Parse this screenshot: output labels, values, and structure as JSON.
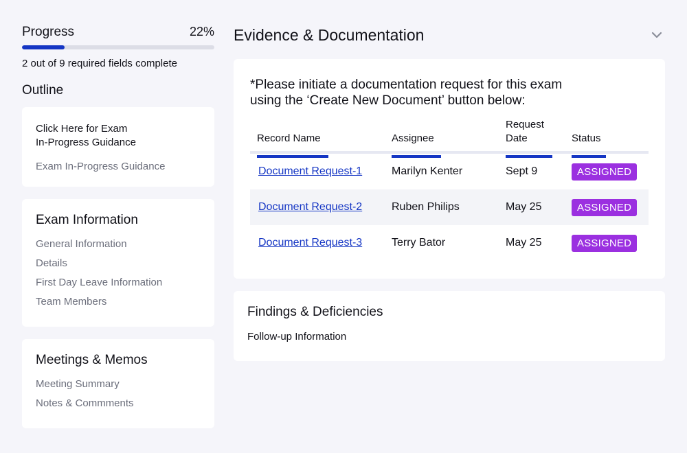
{
  "progress": {
    "title": "Progress",
    "percent_label": "22%",
    "percent": 22,
    "status_text": "2 out of 9 required fields complete",
    "accent": "#1536c4"
  },
  "outline": {
    "title": "Outline",
    "guidance": {
      "link": "Click Here for Exam\nIn-Progress Guidance",
      "sub": "Exam In-Progress Guidance"
    },
    "exam_information": {
      "title": "Exam Information",
      "items": [
        "General Information",
        "Details",
        "First Day Leave Information",
        "Team Members"
      ]
    },
    "meetings_memos": {
      "title": "Meetings & Memos",
      "items": [
        "Meeting Summary",
        "Notes & Commments"
      ]
    }
  },
  "evidence": {
    "title": "Evidence & Documentation",
    "chevron_icon": "chevron-down-icon",
    "instruction": "*Please initiate a documentation request for this exam\nusing the ‘Create New Document’ button below:",
    "columns": [
      "Record Name",
      "Assignee",
      "Request\nDate",
      "Status"
    ],
    "rows": [
      {
        "record": "Document Request-1",
        "assignee": "Marilyn Kenter",
        "date": "Sept 9",
        "status": "ASSIGNED"
      },
      {
        "record": "Document Request-2",
        "assignee": "Ruben Philips",
        "date": "May 25",
        "status": "ASSIGNED"
      },
      {
        "record": "Document Request-3",
        "assignee": "Terry Bator",
        "date": "May 25",
        "status": "ASSIGNED"
      }
    ],
    "status_color": "#9b30e0"
  },
  "findings": {
    "title": "Findings & Deficiencies",
    "item": "Follow-up Information"
  }
}
